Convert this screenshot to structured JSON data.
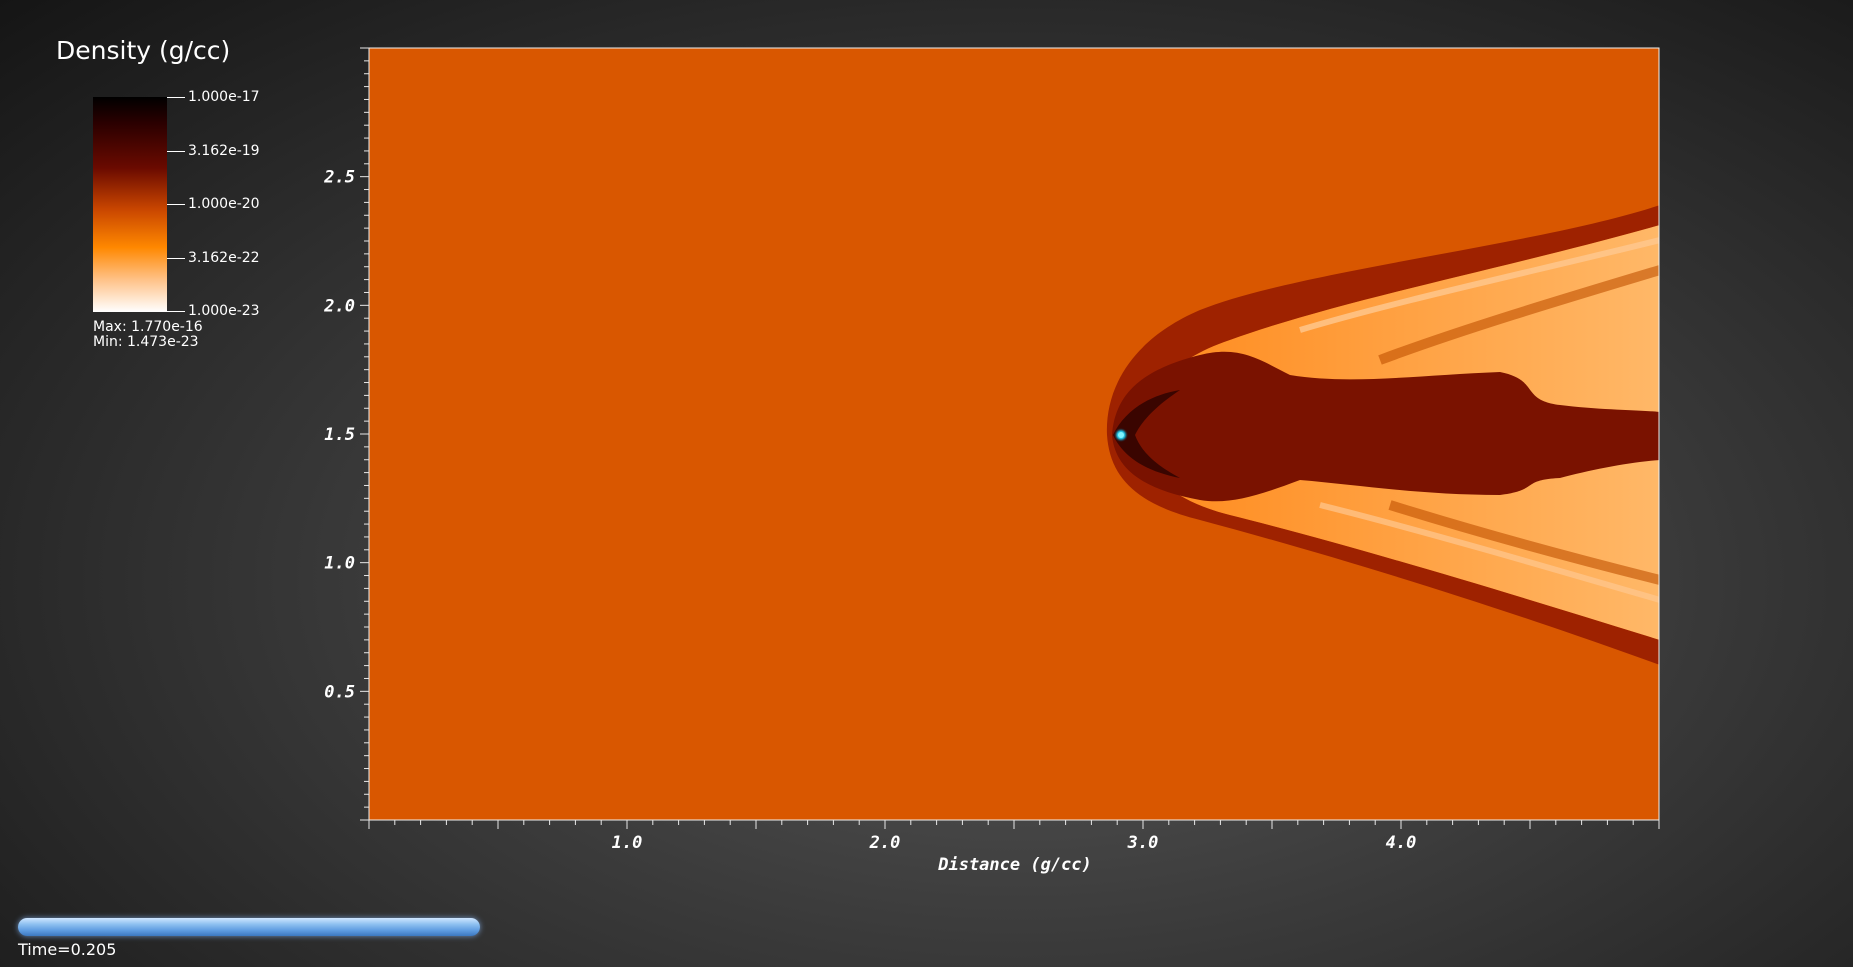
{
  "legend": {
    "title": "Density (g/cc)",
    "ticks": [
      "1.000e-17",
      "3.162e-19",
      "1.000e-20",
      "3.162e-22",
      "1.000e-23"
    ],
    "max_label": "Max:  1.770e-16",
    "min_label": "Min:  1.473e-23"
  },
  "chart_data": {
    "type": "heatmap",
    "variable": "Density (g/cc)",
    "xlabel": "Distance (g/cc)",
    "ylabel": "",
    "xlim": [
      0.0,
      5.0
    ],
    "ylim": [
      0.0,
      3.0
    ],
    "x_ticks": [
      "1.0",
      "2.0",
      "3.0",
      "4.0"
    ],
    "y_ticks": [
      "0.5",
      "1.0",
      "1.5",
      "2.0",
      "2.5"
    ],
    "colormap": [
      "#ffffff",
      "#ff8800",
      "#c84500",
      "#6a0a00",
      "#000000"
    ],
    "background_color": "#d95700",
    "scale": "log",
    "feature": {
      "source_x": 2.92,
      "source_y": 1.5,
      "description_color": "#22c7e0"
    }
  },
  "footer": {
    "time_label": "Time=0.205",
    "progress_color": "#6fa8e6"
  }
}
